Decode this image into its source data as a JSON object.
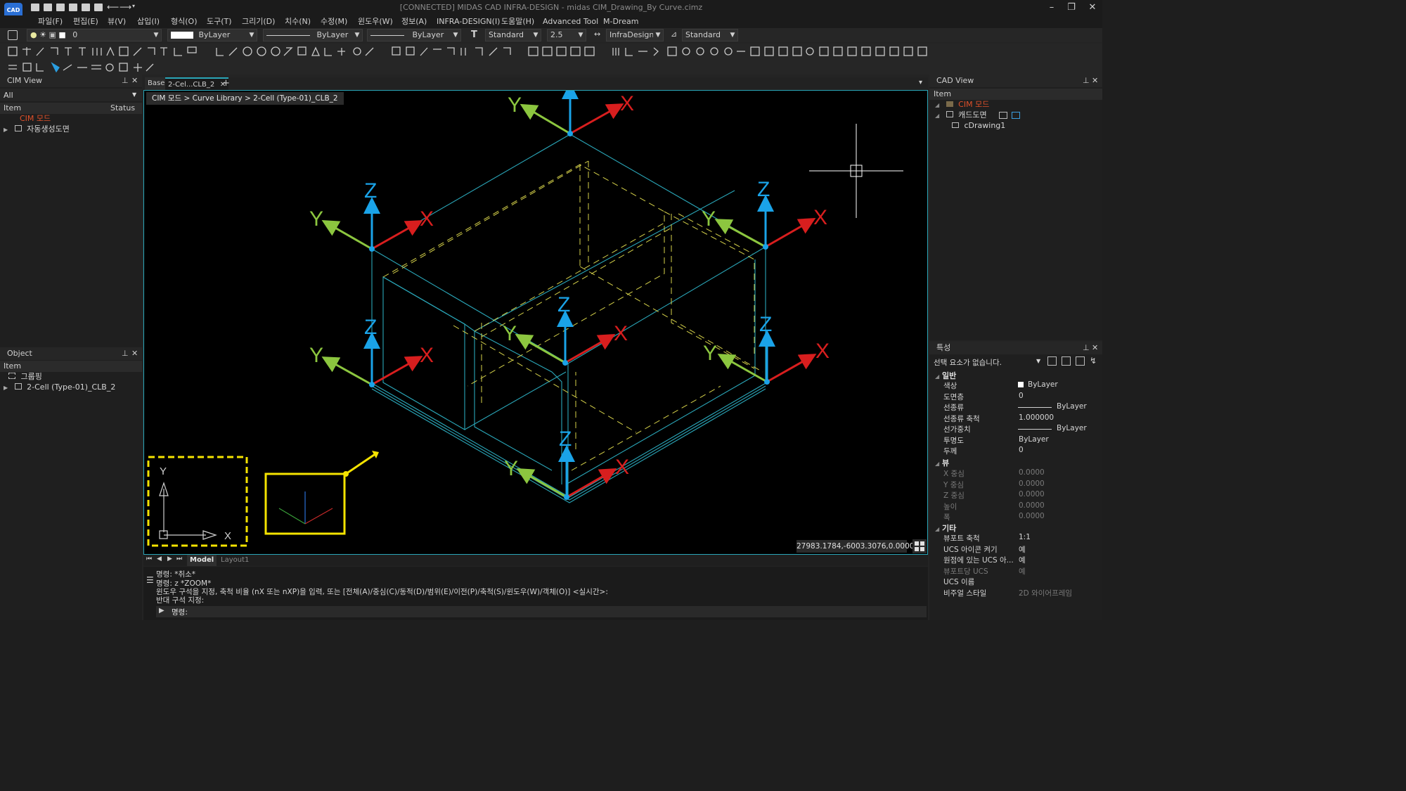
{
  "app": {
    "logo": "CAD",
    "title": "[CONNECTED] MIDAS CAD INFRA-DESIGN - midas CIM_Drawing_By Curve.cimz",
    "window_controls": [
      "–",
      "❐",
      "✕"
    ]
  },
  "menu": [
    "파일(F)",
    "편집(E)",
    "뷰(V)",
    "삽입(I)",
    "형식(O)",
    "도구(T)",
    "그리기(D)",
    "치수(N)",
    "수정(M)",
    "윈도우(W)",
    "정보(A)",
    "INFRA-DESIGN(I)",
    "도움말(H)",
    "Advanced Tool",
    "M-Dream"
  ],
  "toolbar": {
    "layer": "0",
    "color": "ByLayer",
    "linetype": "ByLayer",
    "lineweight": "ByLayer",
    "text_style": "Standard",
    "text_height": "2.5",
    "dim_style": "InfraDesign...",
    "table_style": "Standard"
  },
  "cim_view": {
    "title": "CIM View",
    "filter": "All",
    "col_item": "Item",
    "col_status": "Status",
    "items": [
      "CIM 모드",
      "자동생성도면"
    ]
  },
  "object_panel": {
    "title": "Object",
    "col_item": "Item",
    "items": [
      "그룹핑",
      "2-Cell (Type-01)_CLB_2"
    ]
  },
  "doc_tabs": [
    "Base",
    "2-Cel...CLB_2"
  ],
  "breadcrumb": "CIM 모드 > Curve Library > 2-Cell (Type-01)_CLB_2",
  "coordinates": "27983.1784,-6003.3076,0.0000",
  "layout_tabs": [
    "Model",
    "Layout1"
  ],
  "axis_labels": {
    "x": "X",
    "y": "Y",
    "z": "Z"
  },
  "ucs_icon_labels": {
    "y": "Y",
    "x": "X"
  },
  "cad_view": {
    "title": "CAD View",
    "col_item": "Item",
    "items": [
      "CIM 모드",
      "캐드도면",
      "cDrawing1"
    ]
  },
  "properties": {
    "title": "특성",
    "selection": "선택 요소가 없습니다.",
    "sections": {
      "general": "일반",
      "view": "뷰",
      "misc": "기타"
    },
    "general": [
      {
        "key": "색상",
        "value": "ByLayer"
      },
      {
        "key": "도면층",
        "value": "0"
      },
      {
        "key": "선종류",
        "value": "ByLayer"
      },
      {
        "key": "선종류 축척",
        "value": "1.000000"
      },
      {
        "key": "선가중치",
        "value": "ByLayer"
      },
      {
        "key": "투명도",
        "value": "ByLayer"
      },
      {
        "key": "두께",
        "value": "0"
      }
    ],
    "view": [
      {
        "key": "X 중심",
        "value": "0.0000"
      },
      {
        "key": "Y 중심",
        "value": "0.0000"
      },
      {
        "key": "Z 중심",
        "value": "0.0000"
      },
      {
        "key": "높이",
        "value": "0.0000"
      },
      {
        "key": "폭",
        "value": "0.0000"
      }
    ],
    "misc": [
      {
        "key": "뷰포트 축척",
        "value": "1:1"
      },
      {
        "key": "UCS 아이콘 켜기",
        "value": "예"
      },
      {
        "key": "원점에 있는 UCS 아...",
        "value": "예"
      },
      {
        "key": "뷰포트당 UCS",
        "value": "예"
      },
      {
        "key": "UCS 이름",
        "value": ""
      },
      {
        "key": "비주얼 스타일",
        "value": "2D 와이어프레임"
      }
    ]
  },
  "command": {
    "lines": [
      "명령: *취소*",
      "명령: z *ZOOM*",
      "윈도우 구석을 지정, 축척 비율 (nX 또는 nXP)을 입력, 또는 [전체(A)/중심(C)/동적(D)/범위(E)/이전(P)/축척(S)/윈도우(W)/객체(O)] <실시간>:",
      "반대 구석 지정:"
    ],
    "prompt": "명령:"
  },
  "colors": {
    "cyan": "#2aa6b8",
    "yellow": "#d6d24a",
    "axis_z": "#1aa3e8",
    "axis_x": "#d81e1e",
    "axis_y": "#8cc63f",
    "highlight": "#f5e300"
  }
}
